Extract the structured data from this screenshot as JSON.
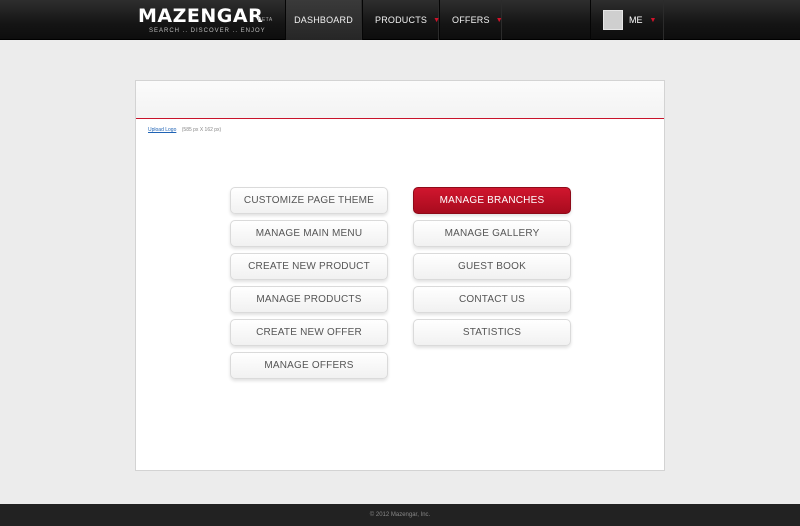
{
  "header": {
    "logo_text": "MAZENGAR",
    "logo_badge": "BETA",
    "tagline": "SEARCH .. DISCOVER .. ENJOY",
    "nav": {
      "dashboard": "DASHBOARD",
      "products": "PRODUCTS",
      "offers": "OFFERS"
    },
    "user_label": "ME",
    "caret_icon": "▼"
  },
  "panel": {
    "upload_link": "Upload Logo",
    "upload_hint": "(585 px X 162 px)"
  },
  "actions": {
    "customize_theme": "CUSTOMIZE PAGE THEME",
    "manage_main_menu": "MANAGE MAIN MENU",
    "create_product": "CREATE NEW PRODUCT",
    "manage_products": "MANAGE PRODUCTS",
    "create_offer": "CREATE NEW OFFER",
    "manage_offers": "MANAGE OFFERS",
    "manage_branches": "MANAGE BRANCHES",
    "manage_gallery": "MANAGE GALLERY",
    "guest_book": "GUEST BOOK",
    "contact_us": "CONTACT US",
    "statistics": "STATISTICS"
  },
  "footer": {
    "copyright": "© 2012 Mazengar, Inc."
  },
  "colors": {
    "accent": "#c8142b",
    "topbar": "#151515",
    "background": "#ececec"
  },
  "icons": {
    "caret": "chevron-down-icon",
    "avatar": "avatar-placeholder"
  }
}
